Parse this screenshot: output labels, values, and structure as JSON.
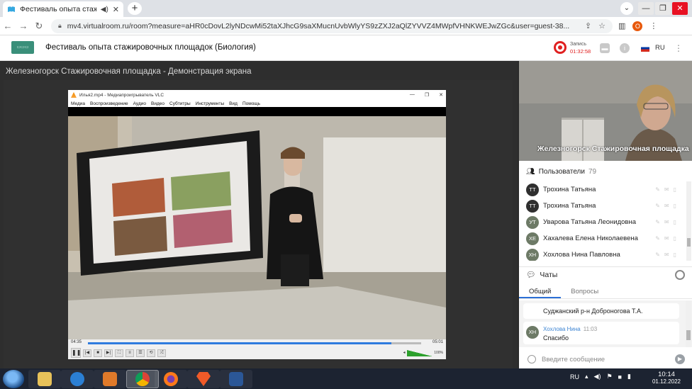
{
  "browser": {
    "tab_title": "Фестиваль опыта стажировс",
    "url": "mv4.virtualroom.ru/room?measure=aHR0cDovL2lyNDcwMi52taXJhcG9saXMucnUvbWlyYS9zZXJ2aQlZYVVZ4MWpfVHNKWEJwZGc&user=guest-38...",
    "profile_initial": "О"
  },
  "app": {
    "event_title": "Фестиваль опыта стажировочных площадок (Биология)",
    "recording_label": "Запись",
    "recording_time": "01:32:58",
    "language": "RU"
  },
  "screen_share": {
    "title": "Железногорск Стажировочная площадка - Демонстрация экрана"
  },
  "vlc": {
    "window_title": "Илья2.mp4 - Медиапроигрыватель VLC",
    "menu": [
      "Медиа",
      "Воспроизведение",
      "Аудио",
      "Видео",
      "Субтитры",
      "Инструменты",
      "Вид",
      "Помощь"
    ],
    "current_time": "04:35",
    "total_time": "05:01",
    "progress": 0.91,
    "volume": "100%"
  },
  "camera": {
    "label": "Железногорск Стажировочная площадка"
  },
  "users": {
    "heading": "Пользователи",
    "count": "79",
    "list": [
      {
        "initials": "ТТ",
        "name": "Трохина Татьяна"
      },
      {
        "initials": "ТТ",
        "name": "Трохина Татьяна"
      },
      {
        "initials": "УТ",
        "name": "Уварова Татьяна Леонидовна"
      },
      {
        "initials": "ХЕ",
        "name": "Хахалева Елена Николаевена"
      },
      {
        "initials": "ХН",
        "name": "Хохлова Нина Павловна"
      }
    ]
  },
  "chat": {
    "heading": "Чаты",
    "tabs": [
      "Общий",
      "Вопросы"
    ],
    "messages": [
      {
        "text": "Суджанский р-н Доброногова Т.А."
      },
      {
        "initials": "ХН",
        "author": "Хохлова Нина",
        "time": "11:03",
        "text": "Спасибо"
      }
    ],
    "input_placeholder": "Введите сообщение"
  },
  "taskbar": {
    "lang": "RU",
    "time": "10:14",
    "date": "01.12.2022"
  },
  "colors": {
    "recording": "#e02020",
    "accent": "#2b6fd6",
    "vlc_progress": "#2f7bde"
  }
}
